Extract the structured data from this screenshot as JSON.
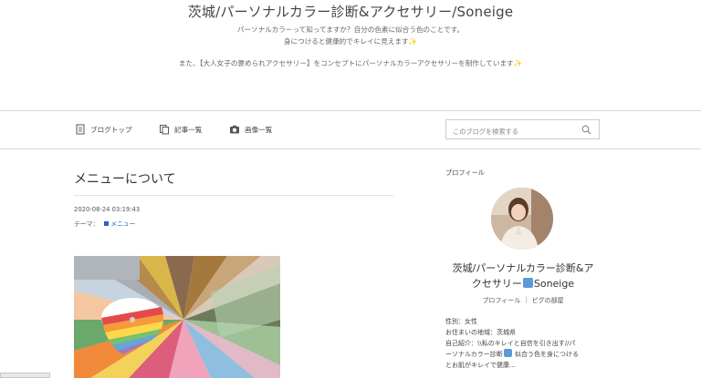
{
  "header": {
    "site_title": "茨城/パーソナルカラー診断&アクセサリー/Soneige",
    "desc_line1": "パーソナルカラーって知ってますか？自分の色素に似合う色のことです。",
    "desc_line2": "身につけると健康的でキレイに見えます✨",
    "desc_line3": "また、【大人女子の褒められアクセサリー】をコンセプトにパーソナルカラーアクセサリーを制作しています✨"
  },
  "nav": {
    "blog_top": "ブログトップ",
    "articles": "記事一覧",
    "images": "画像一覧"
  },
  "search": {
    "placeholder": "このブログを検索する"
  },
  "entry": {
    "title": "メニューについて",
    "date": "2020-08-24 03:19:43",
    "theme_label": "テーマ：",
    "theme_value": "メニュー"
  },
  "profile": {
    "section_label": "プロフィール",
    "name_line1": "茨城/パーソナルカラー診断&ア",
    "name_line2_pre": "クセサリー",
    "name_line2_post": "Soneige",
    "link_profile": "プロフィール",
    "link_separator": "|",
    "link_room": "ピグの部屋",
    "gender": "性別：女性",
    "location": "お住まいの地域：茨城県",
    "intro1": "自己紹介：\\\\私のキレイと自信を引き出す//パ",
    "intro2_pre": "ーソナルカラー診断",
    "intro2_post": "似合う色を身につける",
    "intro3": "とお肌がキレイで健康..."
  },
  "icons": {
    "blog_top": "document-icon",
    "articles": "copy-icon",
    "images": "camera-icon",
    "search": "search-icon",
    "emoji": "paint-emoji-icon"
  },
  "colors": {
    "link": "#2b63c7",
    "divider": "#d6d6d6"
  }
}
